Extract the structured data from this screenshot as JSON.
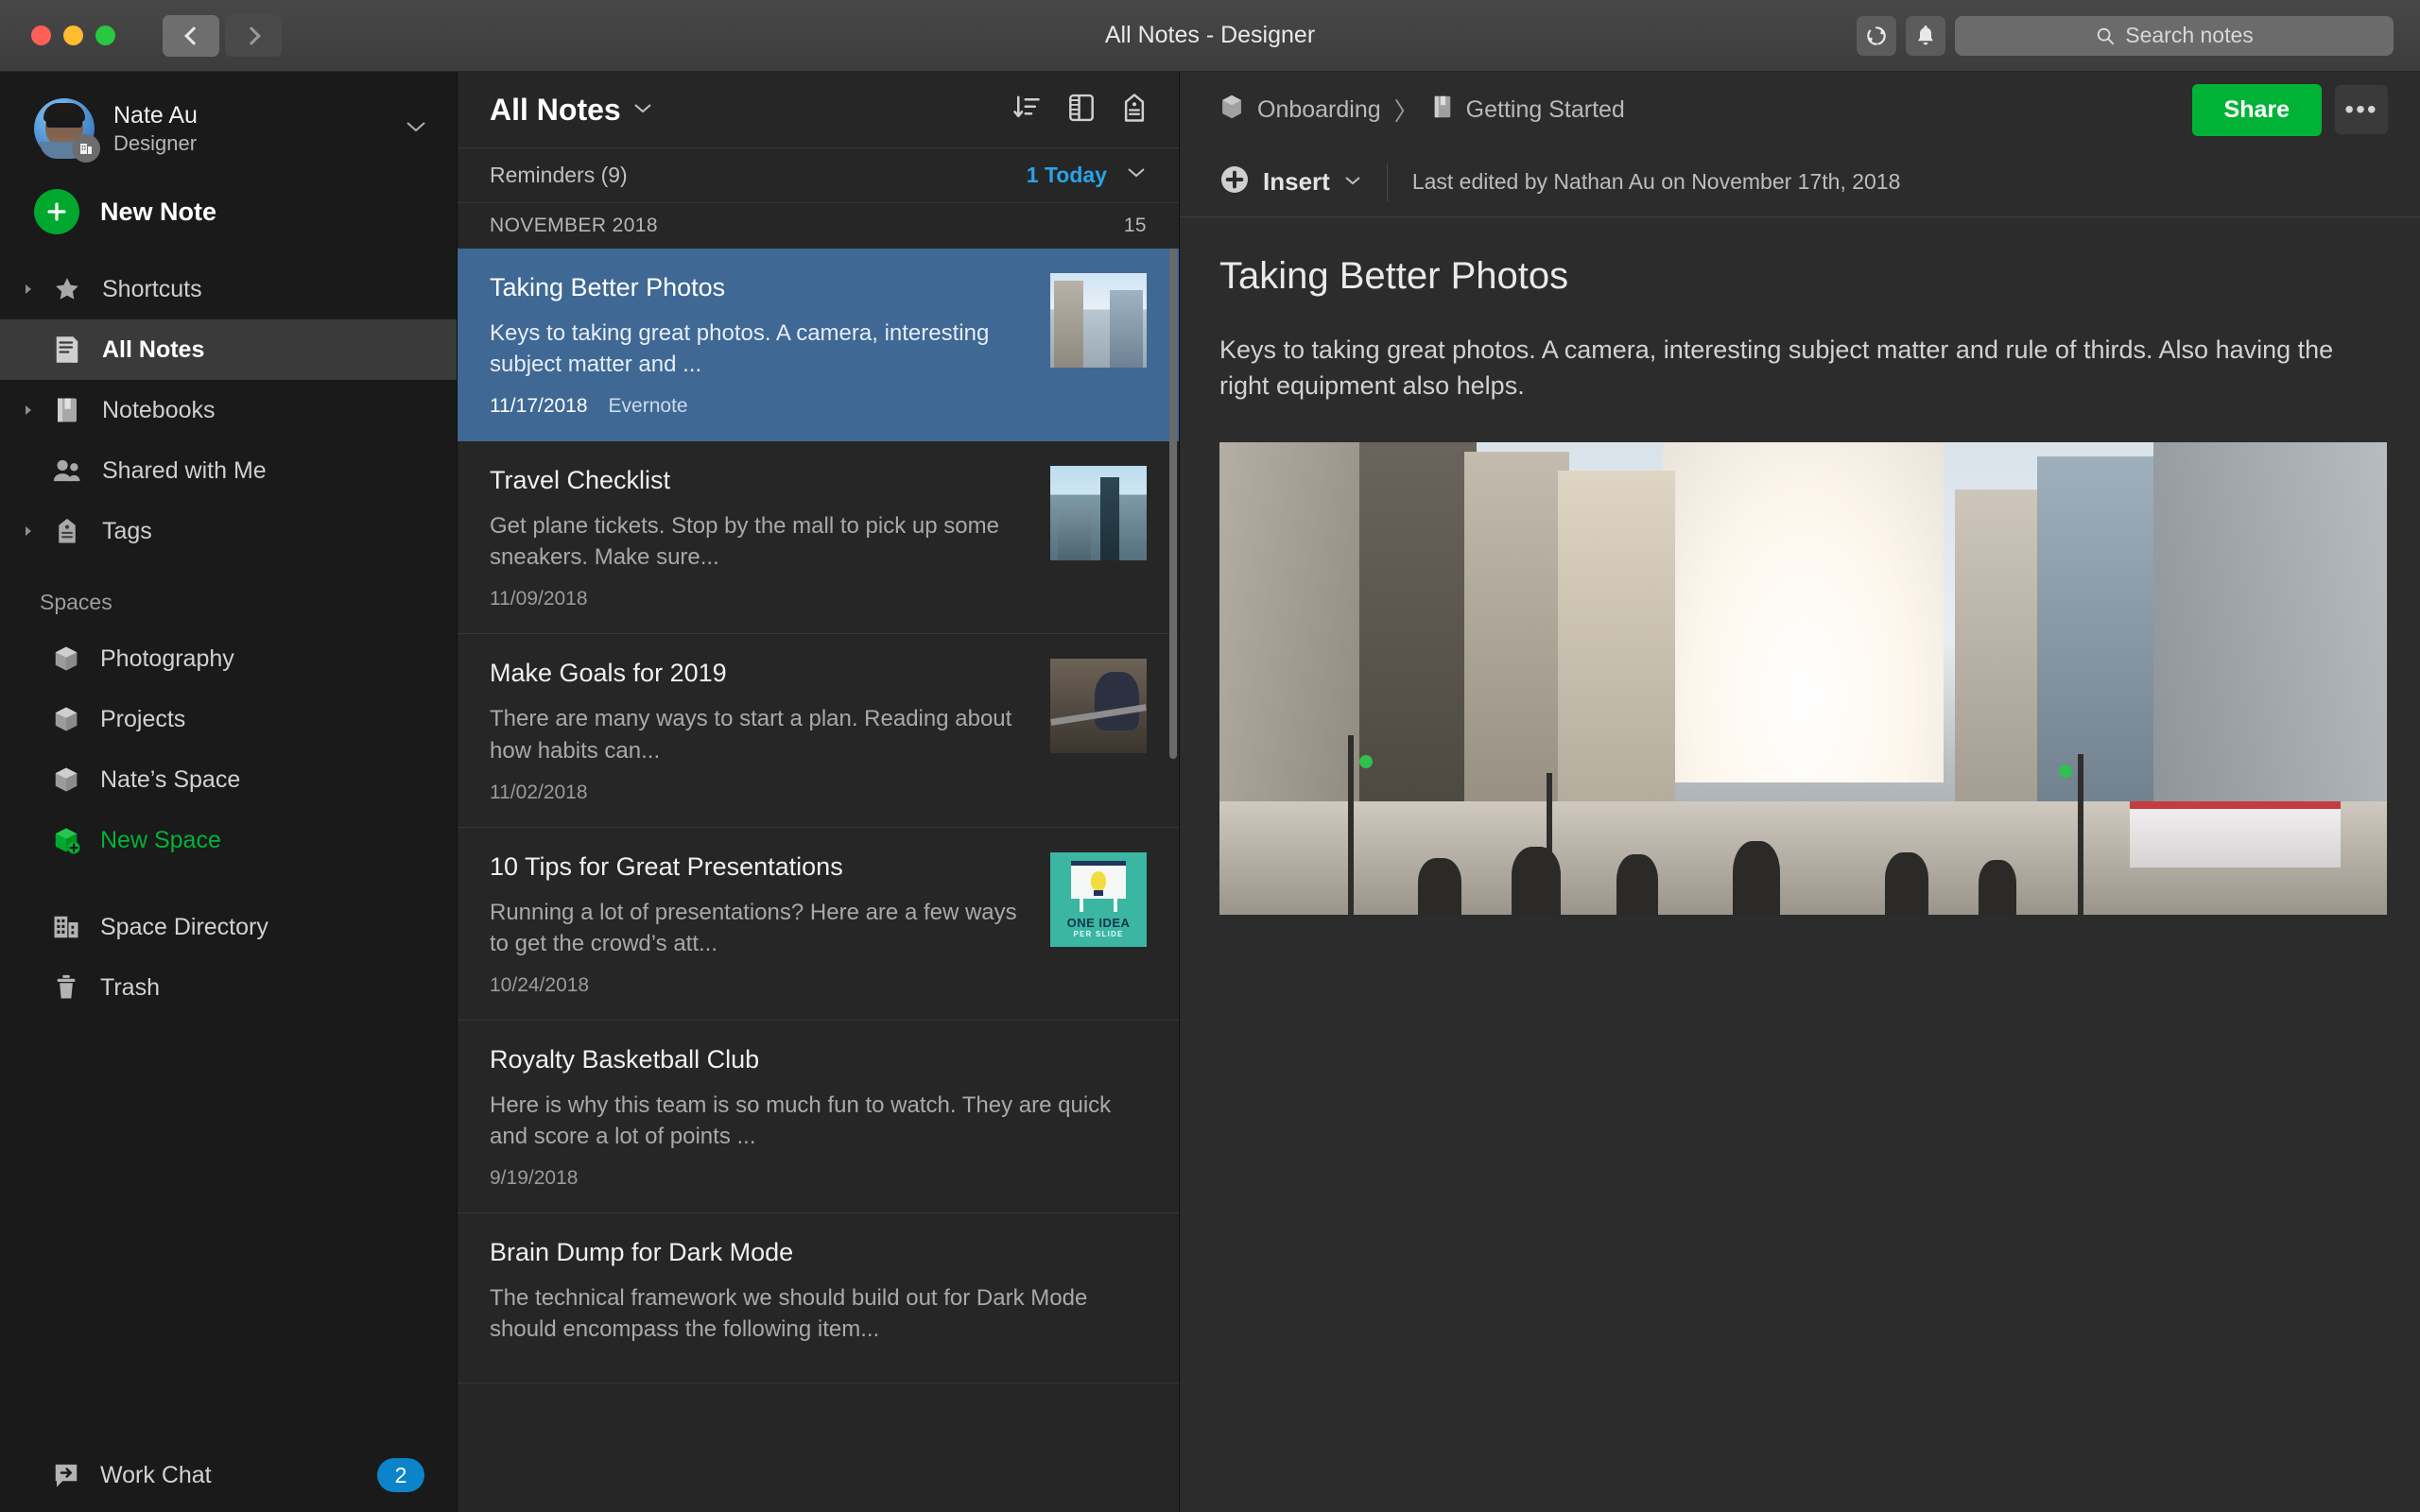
{
  "window": {
    "title": "All Notes - Designer",
    "traffic_lights": [
      "close",
      "minimize",
      "maximize"
    ],
    "back_label": "back",
    "forward_label": "forward",
    "sync_icon": "sync-icon",
    "bell_icon": "bell-icon",
    "search_placeholder": "Search notes"
  },
  "sidebar": {
    "account": {
      "name": "Nate Au",
      "role": "Designer",
      "chevron": "chevron-down-icon",
      "business_badge": "business-badge-icon"
    },
    "new_note_label": "New Note",
    "nav_items": [
      {
        "label": "Shortcuts",
        "icon": "star-icon",
        "disclosure": true,
        "active": false
      },
      {
        "label": "All Notes",
        "icon": "notes-icon",
        "disclosure": false,
        "active": true
      },
      {
        "label": "Notebooks",
        "icon": "notebook-icon",
        "disclosure": true,
        "active": false
      },
      {
        "label": "Shared with Me",
        "icon": "people-icon",
        "disclosure": false,
        "active": false
      },
      {
        "label": "Tags",
        "icon": "tag-icon",
        "disclosure": true,
        "active": false
      }
    ],
    "spaces_label": "Spaces",
    "spaces": [
      {
        "label": "Photography",
        "icon": "cube-icon",
        "accent": false
      },
      {
        "label": "Projects",
        "icon": "cube-icon",
        "accent": false
      },
      {
        "label": "Nate’s Space",
        "icon": "cube-icon",
        "accent": false
      },
      {
        "label": "New Space",
        "icon": "cube-plus-icon",
        "accent": true
      }
    ],
    "footer_items": [
      {
        "label": "Space Directory",
        "icon": "building-icon"
      },
      {
        "label": "Trash",
        "icon": "trash-icon"
      }
    ],
    "work_chat": {
      "label": "Work Chat",
      "icon": "chat-icon",
      "badge": "2"
    },
    "accent_green": "#00b336",
    "badge_blue": "#0b84c9"
  },
  "note_list": {
    "title": "All Notes",
    "title_chevron": "chevron-down-icon",
    "tools": [
      {
        "name": "sort-icon",
        "label": "Sort"
      },
      {
        "name": "view-layout-icon",
        "label": "View"
      },
      {
        "name": "tag-icon",
        "label": "Tags"
      }
    ],
    "reminders_label": "Reminders (9)",
    "reminders_today": "1 Today",
    "reminders_chevron": "chevron-down-icon",
    "month_label": "NOVEMBER 2018",
    "month_count": "15",
    "notes": [
      {
        "title": "Taking Better Photos",
        "snippet": "Keys to taking great photos. A camera, interesting subject matter and ...",
        "date": "11/17/2018",
        "source": "Evernote",
        "thumb": "city-street-photo",
        "selected": true
      },
      {
        "title": "Travel Checklist",
        "snippet": "Get plane tickets. Stop by the mall to pick up some sneakers. Make sure...",
        "date": "11/09/2018",
        "source": "",
        "thumb": "aerial-skyline-photo",
        "selected": false
      },
      {
        "title": "Make Goals for 2019",
        "snippet": "There are many ways to start a plan. Reading about how habits can...",
        "date": "11/02/2018",
        "source": "",
        "thumb": "gym-workout-photo",
        "selected": false
      },
      {
        "title": "10 Tips for Great Presentations",
        "snippet": "Running a lot of presentations? Here are a few ways to get the crowd’s att...",
        "date": "10/24/2018",
        "source": "",
        "thumb": "one-idea-per-slide-graphic",
        "thumb_caption_1": "ONE IDEA",
        "thumb_caption_2": "PER SLIDE",
        "selected": false
      },
      {
        "title": "Royalty Basketball Club",
        "snippet": "Here is why this team is so much fun to watch. They are quick and score a lot of points ...",
        "date": "9/19/2018",
        "source": "",
        "thumb": "",
        "selected": false
      },
      {
        "title": "Brain Dump for Dark Mode",
        "snippet": "The technical framework we should build out for Dark Mode should encompass the following item...",
        "date": "",
        "source": "",
        "thumb": "",
        "selected": false
      }
    ],
    "selected_row_color": "#3f6895"
  },
  "editor": {
    "breadcrumb": [
      {
        "label": "Onboarding",
        "icon": "space-icon"
      },
      {
        "label": "Getting Started",
        "icon": "notebook-icon"
      }
    ],
    "breadcrumb_separator": "〉",
    "share_label": "Share",
    "more_label": "•••",
    "insert_label": "Insert",
    "insert_icon": "plus-circle-icon",
    "insert_chevron": "chevron-down-icon",
    "last_edited": "Last edited by Nathan Au on November 17th, 2018",
    "note_title": "Taking Better Photos",
    "note_body": "Keys to taking great photos. A camera, interesting subject matter and rule of thirds. Also having the right equipment also helps.",
    "hero_image": "san-francisco-street-photo",
    "share_color": "#00b336"
  }
}
